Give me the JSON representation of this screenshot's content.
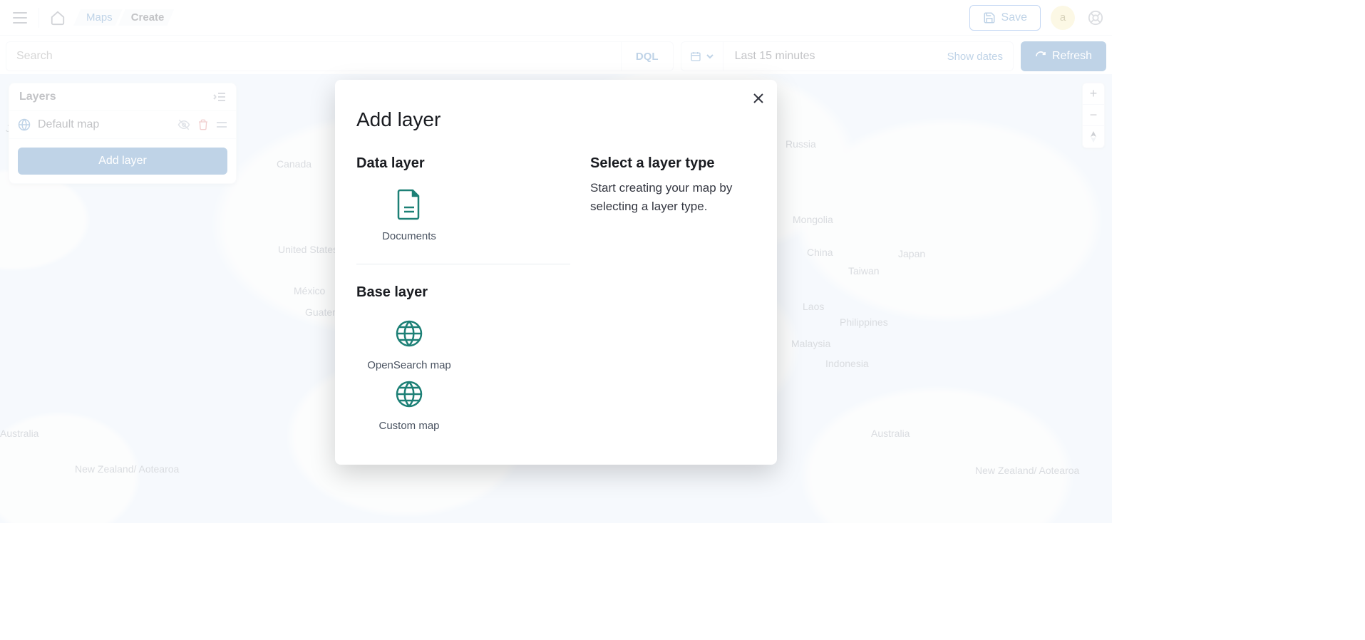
{
  "topbar": {
    "breadcrumbs": [
      "Maps",
      "Create"
    ],
    "save_label": "Save",
    "avatar_letter": "a"
  },
  "filterbar": {
    "search_placeholder": "Search",
    "dql_label": "DQL",
    "time_label": "Last 15 minutes",
    "show_dates_label": "Show dates",
    "refresh_label": "Refresh"
  },
  "layers_panel": {
    "title": "Layers",
    "items": [
      {
        "name": "Default map"
      }
    ],
    "add_button_label": "Add layer"
  },
  "map_labels": {
    "japan": "Japan",
    "canada": "Canada",
    "us": "United States of America",
    "mexico": "México",
    "guatemala": "Guatemala",
    "new_zealand_left": "New Zealand/ Aotearoa",
    "australia_left": "Australia",
    "russia": "Russia",
    "mongolia": "Mongolia",
    "china": "China",
    "taiwan": "Taiwan",
    "japan_right": "Japan",
    "philippines": "Philippines",
    "laos": "Laos",
    "malaysia": "Malaysia",
    "indonesia": "Indonesia",
    "australia_right": "Australia",
    "new_zealand_right": "New Zealand/ Aotearoa"
  },
  "modal": {
    "title": "Add layer",
    "data_layer_heading": "Data layer",
    "base_layer_heading": "Base layer",
    "types": {
      "documents": "Documents",
      "opensearch_map": "OpenSearch map",
      "custom_map": "Custom map"
    },
    "right_heading": "Select a layer type",
    "right_desc": "Start creating your map by selecting a layer type."
  }
}
